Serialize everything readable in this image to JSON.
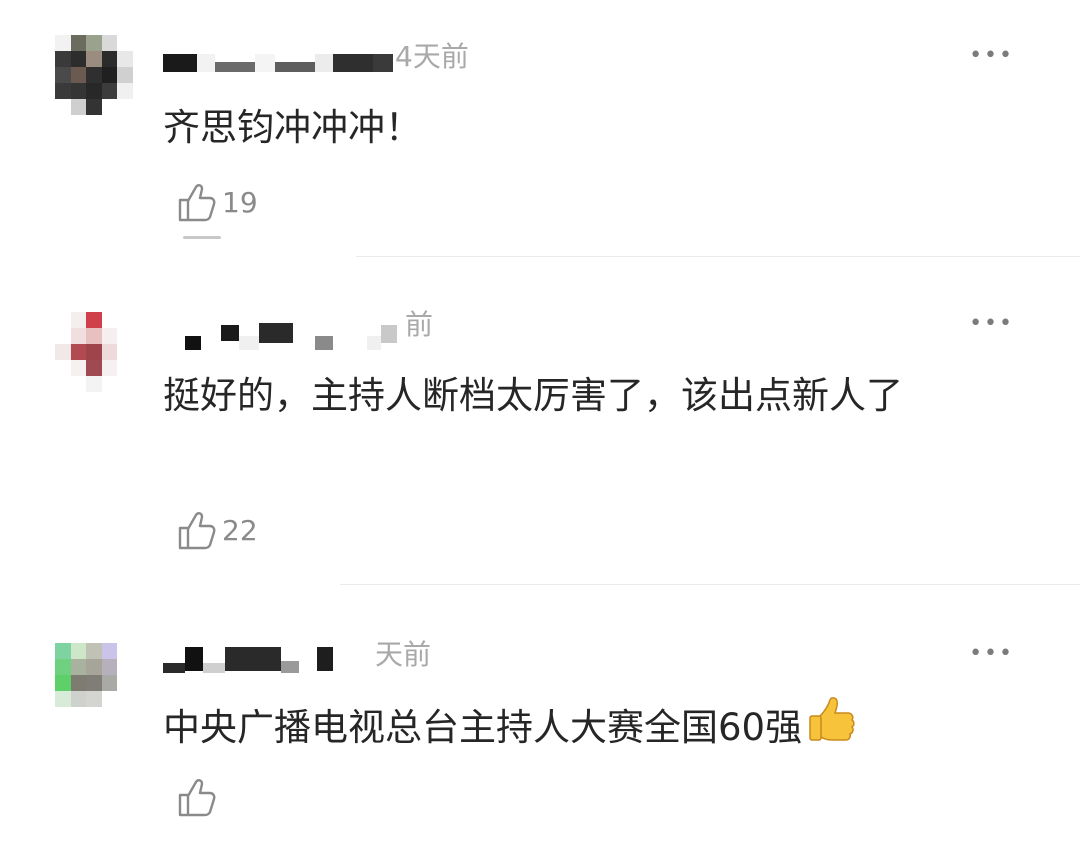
{
  "comments": [
    {
      "time": "4天前",
      "text": "齐思钧冲冲冲！",
      "likes": "19",
      "avatar_colors": [
        "#f2f2f2",
        "#6b6b5e",
        "#9aa28e",
        "#d9d9d9",
        "#ffffff",
        "#3a3a3a",
        "#2d2d2d",
        "#9b8c80",
        "#2b2b2b",
        "#e8e8e8",
        "#4a4a4a",
        "#6b5a50",
        "#2f2f2f",
        "#202020",
        "#d0d0d0",
        "#3a3a3a",
        "#353535",
        "#282828",
        "#3c3c3c",
        "#f0f0f0",
        "#ffffff",
        "#cfcfcf",
        "#333333",
        "#ffffff",
        "#ffffff"
      ]
    },
    {
      "time": "前",
      "text": "挺好的，主持人断档太厉害了，该出点新人了",
      "likes": "22",
      "avatar_colors": [
        "#ffffff",
        "#f4eeee",
        "#d0404a",
        "#ffffff",
        "#ffffff",
        "#ffffff",
        "#f1dede",
        "#e8c0c0",
        "#f6efef",
        "#ffffff",
        "#f3e8e8",
        "#b24a52",
        "#a0444b",
        "#eedada",
        "#ffffff",
        "#ffffff",
        "#f7f0f0",
        "#9e4a50",
        "#f7f0f0",
        "#ffffff",
        "#ffffff",
        "#ffffff",
        "#f3f3f3",
        "#ffffff",
        "#ffffff"
      ]
    },
    {
      "time": "天前",
      "text": "中央广播电视总台主持人大赛全国60强",
      "likes": "",
      "avatar_colors": [
        "#7ed4a0",
        "#cfe7c9",
        "#bfc2b4",
        "#cbc3ea",
        "#ffffff",
        "#6fd07f",
        "#a9b29f",
        "#a7a49a",
        "#b6b0bc",
        "#ffffff",
        "#5dd06a",
        "#7e7c70",
        "#7f7d76",
        "#a9a9a5",
        "#ffffff",
        "#d8ebd8",
        "#cfd2cc",
        "#d4d4d0",
        "#ffffff",
        "#ffffff",
        "#ffffff",
        "#ffffff",
        "#ffffff",
        "#ffffff",
        "#ffffff"
      ]
    }
  ],
  "more_icon": "•••",
  "colors": {
    "time": "#a9a9a9",
    "text": "#262626",
    "likes": "#8a8a8a"
  }
}
